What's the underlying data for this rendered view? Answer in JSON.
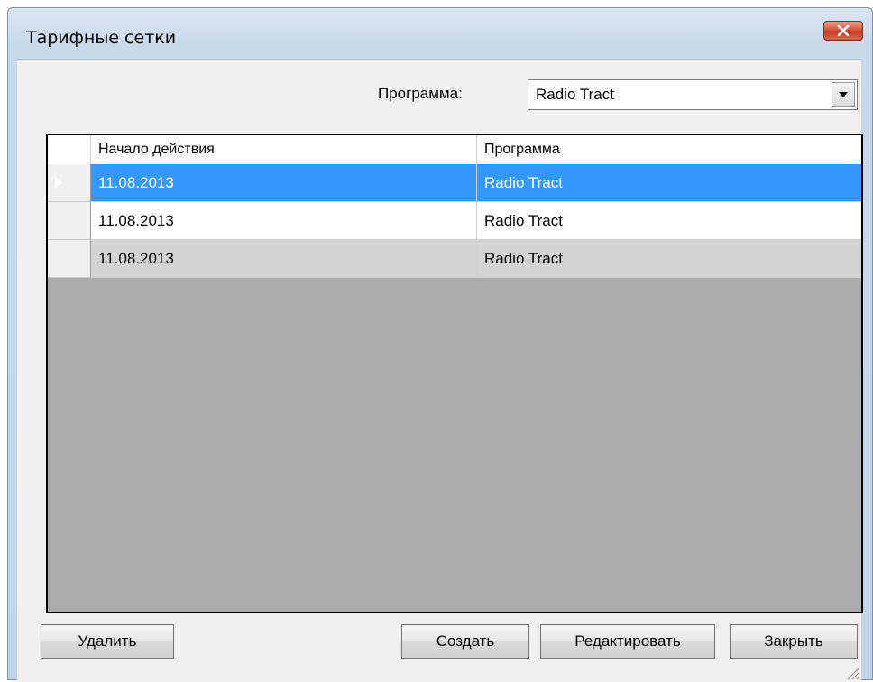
{
  "window": {
    "title": "Тарифные сетки",
    "close_icon": "close-icon"
  },
  "filter": {
    "program_label": "Программа:",
    "program_value": "Radio Tract"
  },
  "grid": {
    "columns": [
      "Начало действия",
      "Программа"
    ],
    "rows": [
      {
        "start": "11.08.2013",
        "program": "Radio Tract",
        "selected": true
      },
      {
        "start": "11.08.2013",
        "program": "Radio Tract",
        "selected": false
      },
      {
        "start": "11.08.2013",
        "program": "Radio Tract",
        "selected": false
      }
    ]
  },
  "buttons": {
    "delete": "Удалить",
    "create": "Создать",
    "edit": "Редактировать",
    "close": "Закрыть"
  },
  "colors": {
    "selection": "#3399ff",
    "grid_background": "#ababab",
    "alt_row": "#d3d3d3",
    "close_button": "#c23a22"
  }
}
